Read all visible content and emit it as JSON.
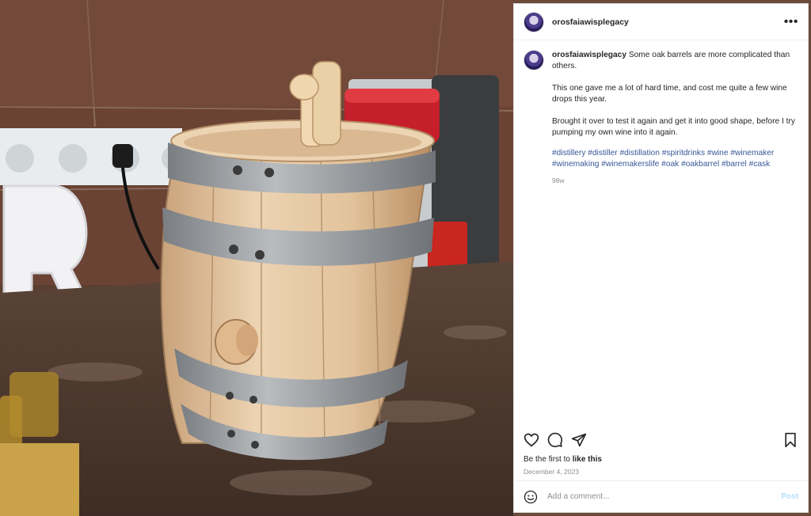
{
  "photo": {
    "subject": "oak-barrel"
  },
  "post": {
    "username": "orosfaiawisplegacy",
    "more_icon": "more-horizontal-icon",
    "caption": {
      "username": "orosfaiawisplegacy",
      "line1": "Some oak barrels are more complicated than others.",
      "para2": "This one gave me a lot of hard time, and cost me quite a few wine drops this year.",
      "para3": "Brought it over to test it again and get it into good shape, before I try pumping my own wine into it again.",
      "hashtags": "#distillery #distiller #distillation #spiritdrinks #wine #winemaker #winemaking #winemakerslife #oak #oakbarrel #barrel #cask",
      "age": "98w"
    },
    "likes_prefix": "Be the first to",
    "likes_action": "like this",
    "date": "December 4, 2023",
    "comment_placeholder": "Add a comment...",
    "post_label": "Post"
  },
  "icons": [
    "heart-icon",
    "comment-icon",
    "share-icon",
    "bookmark-icon",
    "emoji-icon"
  ],
  "colors": {
    "link": "#385898",
    "post_button": "#b2dffc",
    "muted": "#8e8e8e"
  }
}
